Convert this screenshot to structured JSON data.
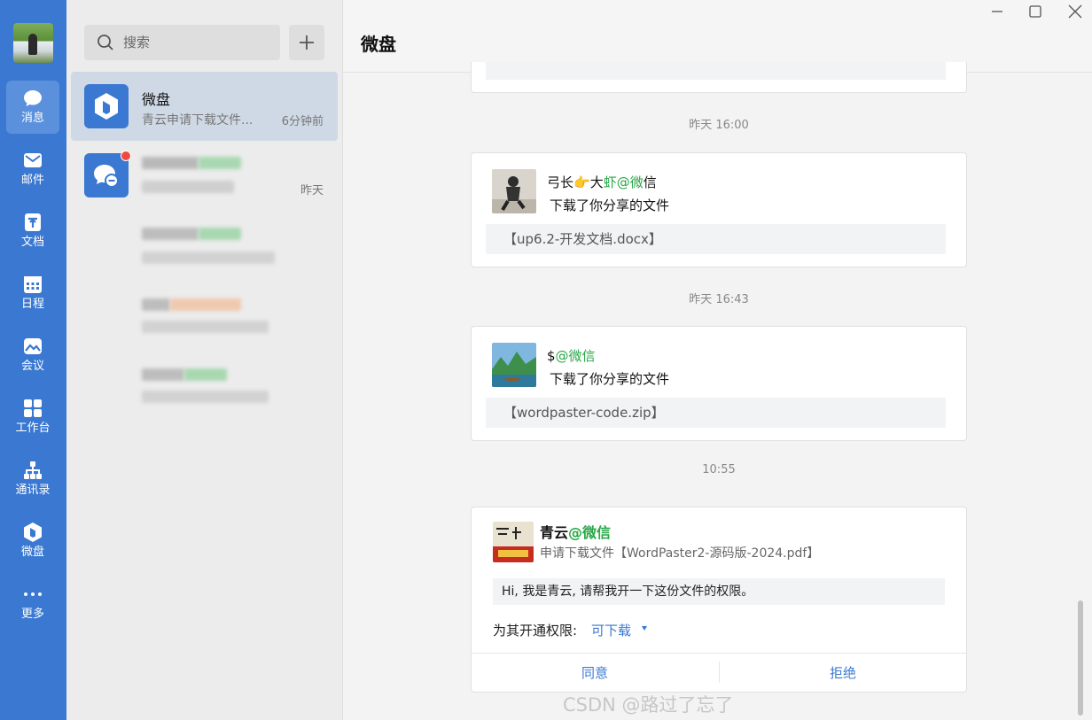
{
  "rail": {
    "items": [
      {
        "label": "消息",
        "icon": "chat-bubble-icon",
        "active": true
      },
      {
        "label": "邮件",
        "icon": "mail-icon"
      },
      {
        "label": "文档",
        "icon": "document-icon"
      },
      {
        "label": "日程",
        "icon": "calendar-icon"
      },
      {
        "label": "会议",
        "icon": "meeting-icon"
      },
      {
        "label": "工作台",
        "icon": "workbench-icon"
      },
      {
        "label": "通讯录",
        "icon": "contacts-icon"
      },
      {
        "label": "微盘",
        "icon": "weipan-icon"
      },
      {
        "label": "更多",
        "icon": "more-dots-icon"
      }
    ]
  },
  "search": {
    "placeholder": "搜索"
  },
  "conversations": [
    {
      "name": "微盘",
      "preview": "青云申请下载文件...",
      "time": "6分钟前",
      "selected": true
    },
    {
      "name": "",
      "preview": "",
      "time": "昨天",
      "unread": true
    }
  ],
  "header": {
    "title": "微盘"
  },
  "timeline": [
    {
      "timestamp": "昨天 16:00",
      "name": "弓长",
      "emoji": "👉",
      "name_suffix": "大",
      "org": "虾@微",
      "org_suffix": "信",
      "action": "下载了你分享的文件",
      "file": "【up6.2-开发文档.docx】"
    },
    {
      "timestamp": "昨天 16:43",
      "name": "$",
      "org": "@微信",
      "action": "下载了你分享的文件",
      "file": "【wordpaster-code.zip】"
    }
  ],
  "request": {
    "timestamp": "10:55",
    "name": "青云",
    "org": "@微信",
    "subtitle": "申请下载文件【WordPaster2-源码版-2024.pdf】",
    "message": "Hi, 我是青云, 请帮我开一下这份文件的权限。",
    "permission_label": "为其开通权限:",
    "permission_value": "可下载",
    "agree_label": "同意",
    "reject_label": "拒绝"
  },
  "watermark": "CSDN @路过了忘了",
  "colors": {
    "rail": "#3a78d1",
    "accent": "#3a78d1",
    "green": "#27a846",
    "unread": "#f04a3e"
  }
}
